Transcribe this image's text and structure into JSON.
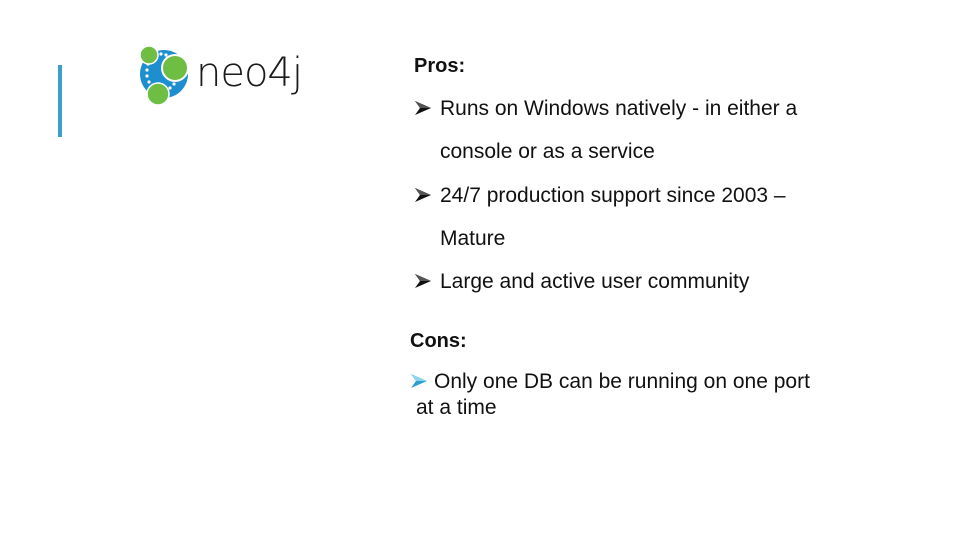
{
  "logo": {
    "text": "neo4j",
    "icon": "neo4j-graph-logo-icon",
    "colors": {
      "blue": "#1d8fcf",
      "green": "#6fbe44",
      "dots": "#ffffff"
    }
  },
  "accent_color": "#3a9fc9",
  "pros": {
    "heading": "Pros:",
    "bullet_icon": "arrow-bullet-icon",
    "bullet_color": "#111111",
    "items": [
      {
        "line1": "Runs on Windows natively - in either a",
        "line2": "console or as a service"
      },
      {
        "line1": "24/7 production support since 2003 –",
        "line2": "Mature"
      },
      {
        "line1": "Large and active user community",
        "line2": ""
      }
    ]
  },
  "cons": {
    "heading": "Cons:",
    "bullet_icon": "arrow-bullet-icon",
    "bullet_color": "#2a9fd0",
    "items": [
      {
        "line1": "Only one DB can be running on one port",
        "line2": "at a time"
      }
    ]
  }
}
